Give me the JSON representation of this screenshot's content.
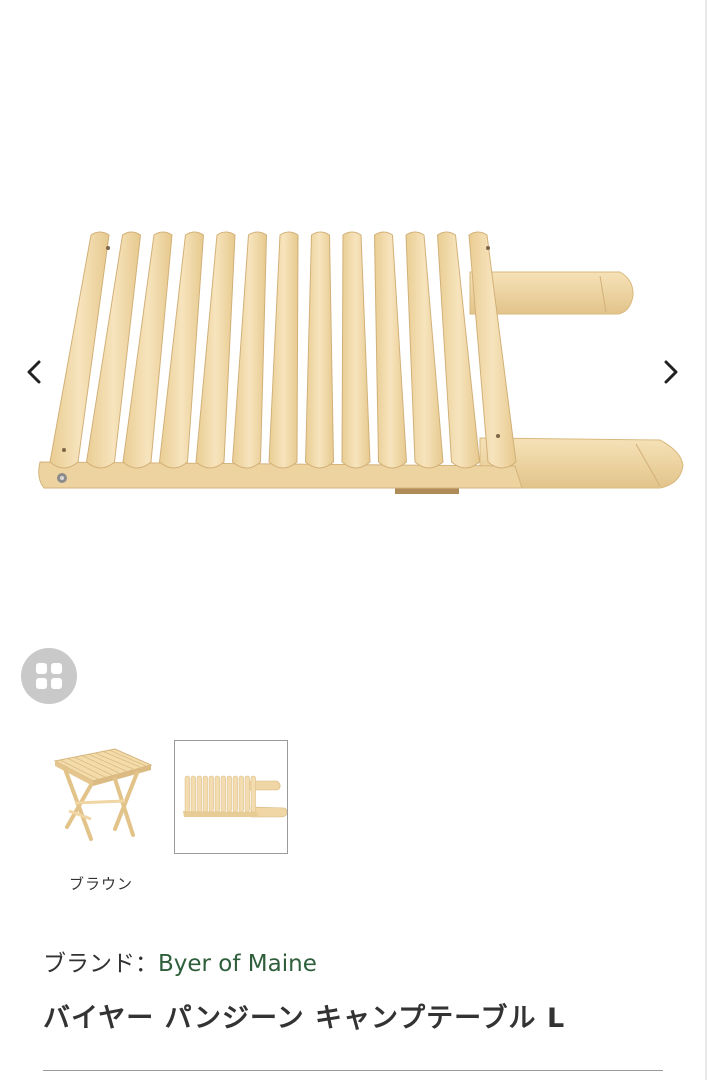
{
  "carousel": {
    "prev_icon": "chevron-left-icon",
    "next_icon": "chevron-right-icon",
    "gallery_icon": "grid-icon"
  },
  "thumbnails": [
    {
      "label": "ブラウン",
      "icon": "assembled-table-thumbnail"
    },
    {
      "label": "",
      "icon": "folded-table-thumbnail"
    }
  ],
  "product": {
    "brand_prefix": "ブランド：",
    "brand_name": "Byer of Maine",
    "title": "バイヤー パンジーン キャンプテーブル L"
  },
  "colors": {
    "brand_link": "#2e5e3a",
    "wood": "#f1d9a8",
    "gallery_button": "#c9c9c9"
  }
}
